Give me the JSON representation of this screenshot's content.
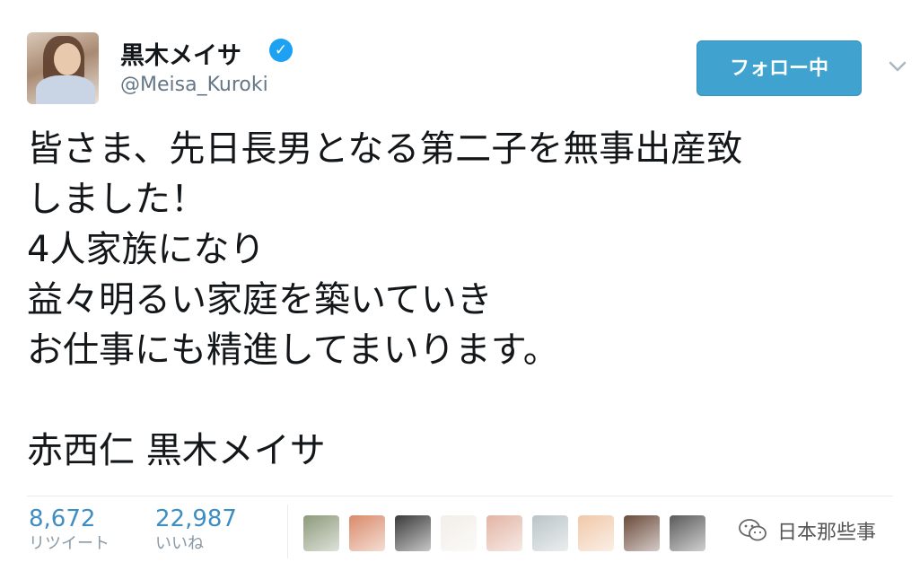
{
  "profile": {
    "display_name": "黒木メイサ",
    "handle": "@Meisa_Kuroki",
    "verified_icon": "verified-check-icon"
  },
  "follow_button": {
    "label": "フォロー中"
  },
  "tweet": {
    "lines": [
      "皆さま、先日長男となる第二子を無事出産致",
      "しました！",
      "4人家族になり",
      "益々明るい家庭を築いていき",
      "お仕事にも精進してまいります。",
      "",
      "赤西仁  黒木メイサ"
    ]
  },
  "stats": {
    "retweets": {
      "count": "8,672",
      "label": "リツイート"
    },
    "likes": {
      "count": "22,987",
      "label": "いいね"
    }
  },
  "likers": [
    {
      "name": "liker-avatar-1",
      "color": "#8c9a7a"
    },
    {
      "name": "liker-avatar-2",
      "color": "#d98a6a"
    },
    {
      "name": "liker-avatar-3",
      "color": "#3a3a3a"
    },
    {
      "name": "liker-avatar-4",
      "color": "#f2eee8"
    },
    {
      "name": "liker-avatar-5",
      "color": "#e2b4a4"
    },
    {
      "name": "liker-avatar-6",
      "color": "#b9c4c8"
    },
    {
      "name": "liker-avatar-7",
      "color": "#f0c8a8"
    },
    {
      "name": "liker-avatar-8",
      "color": "#6a4a3a"
    },
    {
      "name": "liker-avatar-9",
      "color": "#5a5a5a"
    }
  ],
  "watermark": {
    "text": "日本那些事"
  },
  "colors": {
    "accent": "#3fa2cf",
    "stat_number": "#3e8ec4",
    "verified": "#1da1f2"
  }
}
